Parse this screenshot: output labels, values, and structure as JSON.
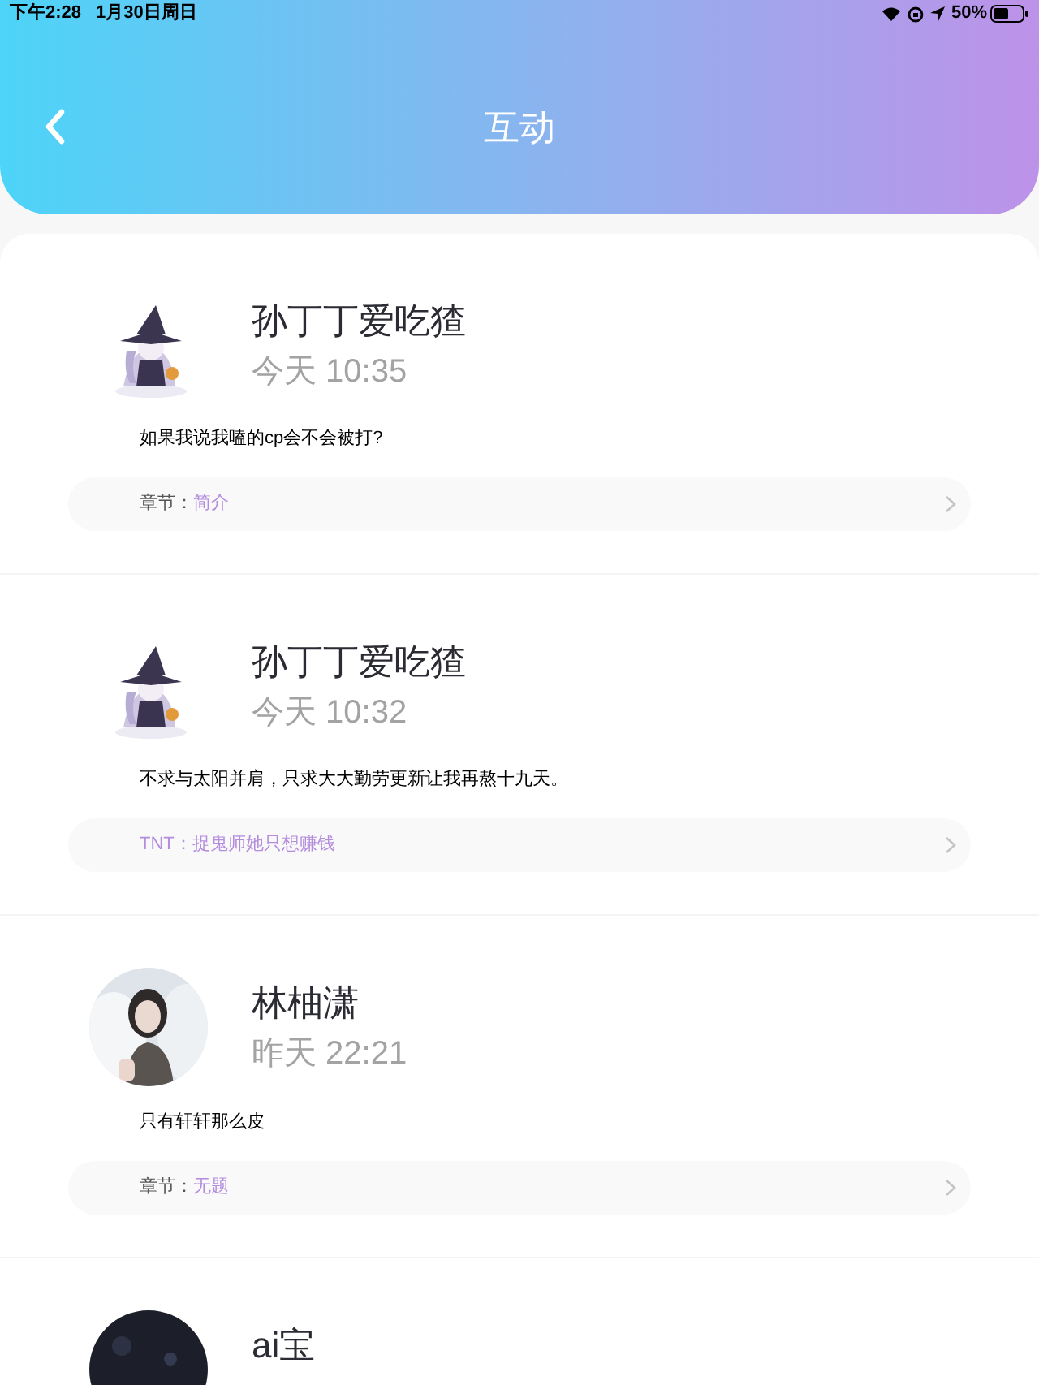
{
  "status_bar": {
    "time": "下午2:28",
    "date": "1月30日周日",
    "battery": "50%"
  },
  "header": {
    "title": "互动"
  },
  "comments": [
    {
      "avatar": {
        "kind": "illustration"
      },
      "name": "孙丁丁爱吃猹",
      "time": "今天 10:35",
      "text": "如果我说我嗑的cp会不会被打?",
      "chapter": {
        "label": "章节：",
        "value": "简介"
      }
    },
    {
      "avatar": {
        "kind": "illustration"
      },
      "name": "孙丁丁爱吃猹",
      "time": "今天 10:32",
      "text": "不求与太阳并肩，只求大大勤劳更新让我再熬十九天。",
      "chapter": {
        "value": "TNT：捉鬼师她只想赚钱"
      }
    },
    {
      "name": "林柚潇",
      "time": "昨天 22:21",
      "text": "只有轩轩那么皮",
      "chapter": {
        "label": "章节：",
        "value": "无题"
      }
    },
    {
      "avatar": {
        "kind": "dark"
      },
      "name": "ai宝"
    }
  ]
}
